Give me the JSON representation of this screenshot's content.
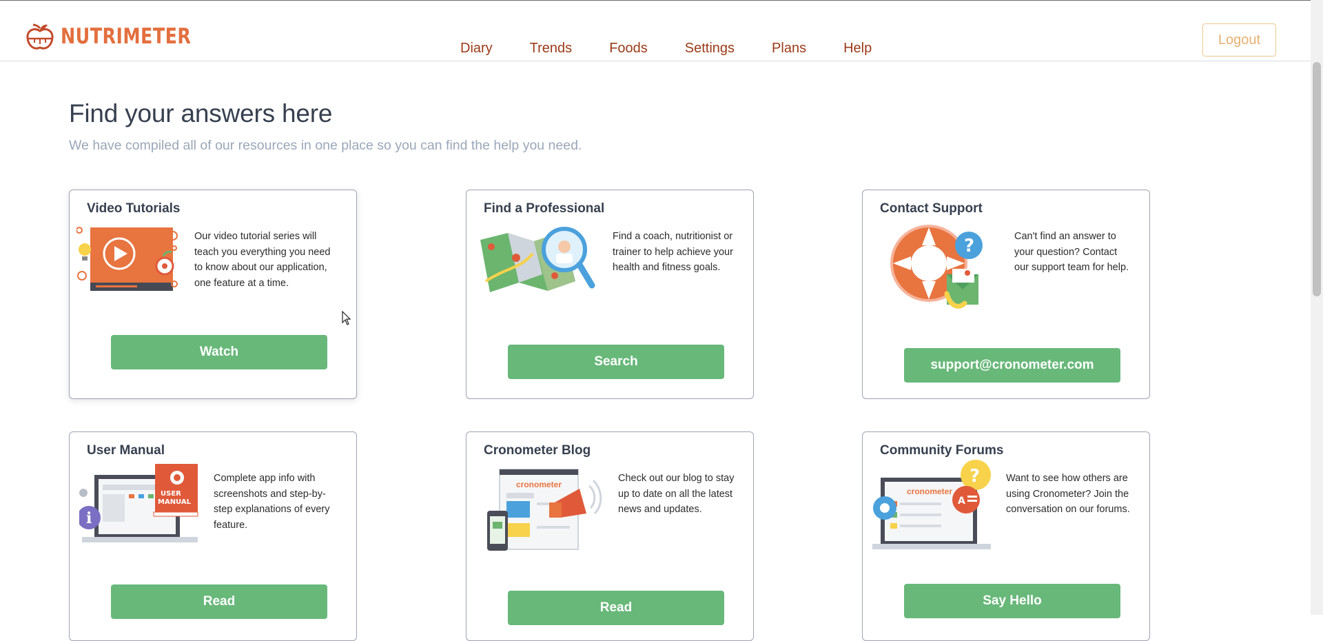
{
  "header": {
    "logo_text": "NUTRIMETER",
    "nav": [
      "Diary",
      "Trends",
      "Foods",
      "Settings",
      "Plans",
      "Help"
    ],
    "logout_label": "Logout"
  },
  "main": {
    "title": "Find your answers here",
    "subtitle": "We have compiled all of our resources in one place so you can find the help you need.",
    "cards": [
      {
        "title": "Video Tutorials",
        "description": "Our video tutorial series will teach you everything you need to know about our application, one feature at a time.",
        "button": "Watch",
        "icon": "video-tutorial-illustration"
      },
      {
        "title": "Find a Professional",
        "description": "Find a coach, nutritionist or trainer to help achieve your health and fitness goals.",
        "button": "Search",
        "icon": "map-magnifier-illustration"
      },
      {
        "title": "Contact Support",
        "description": "Can't find an answer to your question? Contact our support team for help.",
        "button": "support@cronometer.com",
        "icon": "lifebuoy-illustration"
      },
      {
        "title": "User Manual",
        "description": "Complete app info with screenshots and step-by-step explanations of every feature.",
        "button": "Read",
        "icon": "user-manual-illustration",
        "book_label": "USER MANUAL"
      },
      {
        "title": "Cronometer Blog",
        "description": "Check out our blog to stay up to date on all the latest news and updates.",
        "button": "Read",
        "icon": "blog-megaphone-illustration",
        "brand": "cronometer"
      },
      {
        "title": "Community Forums",
        "description": "Want to see how others are using Cronometer? Join the conversation on our forums.",
        "button": "Say Hello",
        "icon": "forum-chat-illustration",
        "brand": "cronometer"
      }
    ]
  },
  "colors": {
    "brand": "#e36f3e",
    "nav_link": "#9a3a18",
    "button_green": "#68b87a",
    "logout_border": "#ecc98f"
  }
}
